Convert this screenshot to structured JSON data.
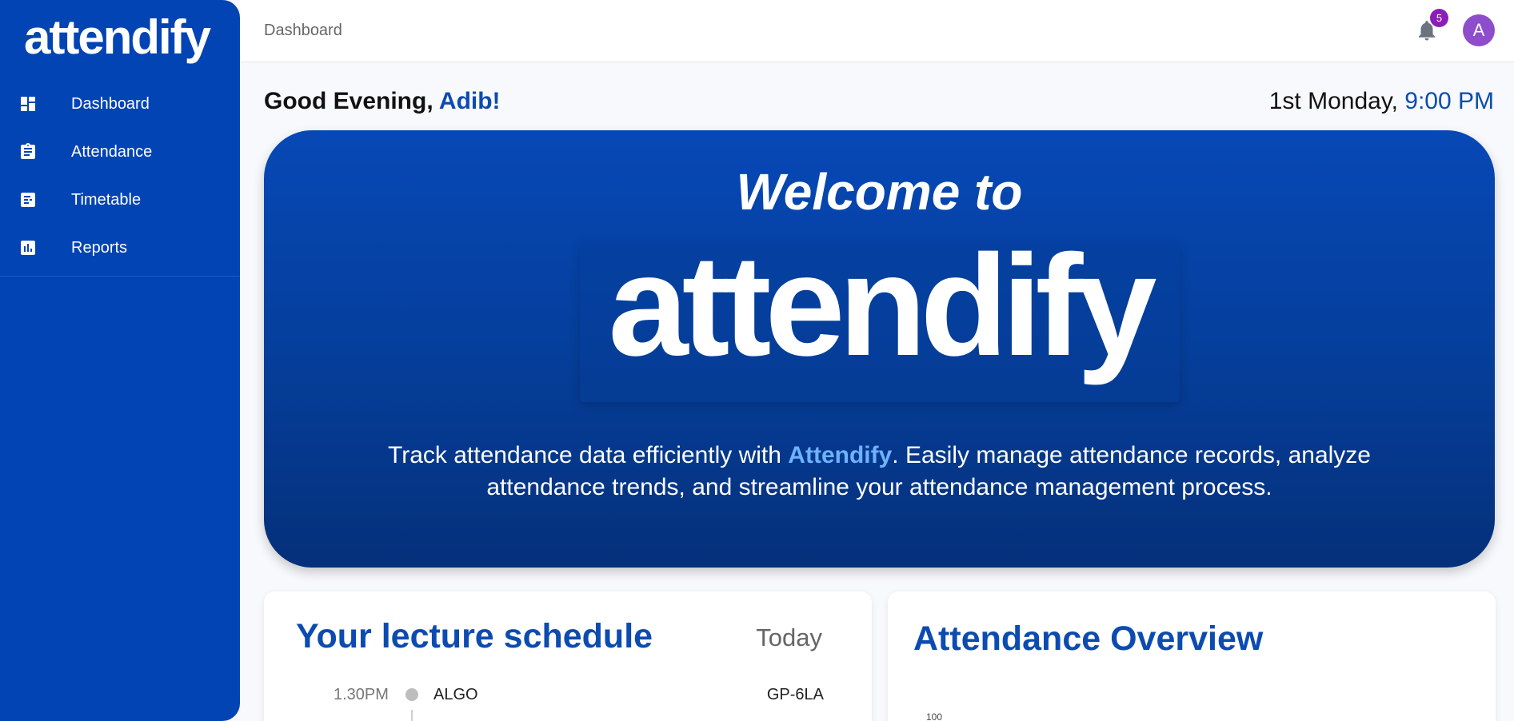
{
  "app": {
    "logo_text": "attendify"
  },
  "sidebar": {
    "items": [
      {
        "label": "Dashboard",
        "icon": "dashboard-icon"
      },
      {
        "label": "Attendance",
        "icon": "clipboard-icon"
      },
      {
        "label": "Timetable",
        "icon": "timetable-icon"
      },
      {
        "label": "Reports",
        "icon": "bar-chart-icon"
      }
    ]
  },
  "header": {
    "breadcrumb": "Dashboard",
    "notification_count": "5",
    "avatar_initial": "A"
  },
  "greeting": {
    "prefix": "Good Evening, ",
    "name": "Adib!",
    "date": "1st Monday, ",
    "time": "9:00 PM"
  },
  "hero": {
    "title": "Welcome to",
    "logo": "attendify",
    "desc_before": "Track attendance data efficiently with ",
    "desc_brand": "Attendify",
    "desc_after": ". Easily manage attendance records, analyze attendance trends, and streamline your attendance management process."
  },
  "schedule": {
    "title": "Your lecture schedule",
    "day": "Today",
    "items": [
      {
        "time": "1.30PM",
        "subject": "ALGO",
        "room": "GP-6LA"
      }
    ]
  },
  "overview": {
    "title": "Attendance Overview",
    "y_tick_top": "100"
  },
  "colors": {
    "sidebar": "#0344b4",
    "accent": "#0c4bb0",
    "brand_highlight": "#6fb2ff",
    "badge": "#8b1fb5",
    "avatar": "#8e4dcc"
  }
}
